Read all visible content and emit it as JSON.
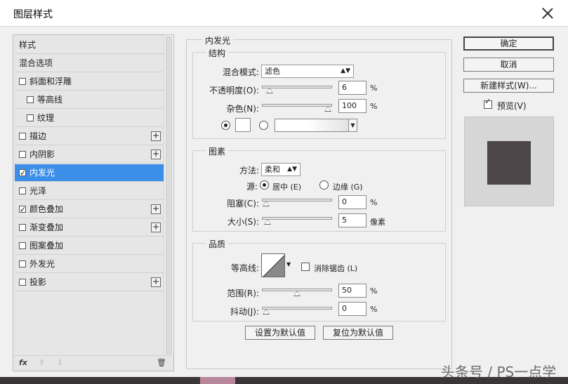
{
  "window": {
    "title": "图层样式"
  },
  "left_panel": {
    "items": [
      {
        "label": "样式",
        "checkbox": false,
        "checked": false,
        "plus": false,
        "indent": false,
        "selected": false
      },
      {
        "label": "混合选项",
        "checkbox": false,
        "checked": false,
        "plus": false,
        "indent": false,
        "selected": false
      },
      {
        "label": "斜面和浮雕",
        "checkbox": true,
        "checked": false,
        "plus": false,
        "indent": false,
        "selected": false
      },
      {
        "label": "等高线",
        "checkbox": true,
        "checked": false,
        "plus": false,
        "indent": true,
        "selected": false
      },
      {
        "label": "纹理",
        "checkbox": true,
        "checked": false,
        "plus": false,
        "indent": true,
        "selected": false
      },
      {
        "label": "描边",
        "checkbox": true,
        "checked": false,
        "plus": true,
        "indent": false,
        "selected": false
      },
      {
        "label": "内阴影",
        "checkbox": true,
        "checked": false,
        "plus": true,
        "indent": false,
        "selected": false
      },
      {
        "label": "内发光",
        "checkbox": true,
        "checked": true,
        "plus": false,
        "indent": false,
        "selected": true
      },
      {
        "label": "光泽",
        "checkbox": true,
        "checked": false,
        "plus": false,
        "indent": false,
        "selected": false
      },
      {
        "label": "颜色叠加",
        "checkbox": true,
        "checked": true,
        "plus": true,
        "indent": false,
        "selected": false
      },
      {
        "label": "渐变叠加",
        "checkbox": true,
        "checked": false,
        "plus": true,
        "indent": false,
        "selected": false
      },
      {
        "label": "图案叠加",
        "checkbox": true,
        "checked": false,
        "plus": false,
        "indent": false,
        "selected": false
      },
      {
        "label": "外发光",
        "checkbox": true,
        "checked": false,
        "plus": false,
        "indent": false,
        "selected": false
      },
      {
        "label": "投影",
        "checkbox": true,
        "checked": false,
        "plus": true,
        "indent": false,
        "selected": false
      }
    ],
    "footer": {
      "fx": "fx",
      "up": "⇧",
      "down": "⇩",
      "trash": "🗑"
    }
  },
  "inner_glow": {
    "section_title": "内发光",
    "structure": {
      "title": "结构",
      "blend_mode_label": "混合模式:",
      "blend_mode_value": "滤色",
      "opacity_label": "不透明度(O):",
      "opacity_value": "6",
      "opacity_level": 6,
      "noise_label": "杂色(N):",
      "noise_value": "100",
      "noise_level": 100,
      "percent": "%"
    },
    "elements": {
      "title": "图素",
      "method_label": "方法:",
      "method_value": "柔和",
      "source_label": "源:",
      "source_center": "居中 (E)",
      "source_edge": "边缘 (G)",
      "choke_label": "阻塞(C):",
      "choke_value": "0",
      "choke_level": 0,
      "size_label": "大小(S):",
      "size_value": "5",
      "size_level": 2,
      "px_unit": "像素",
      "percent": "%"
    },
    "quality": {
      "title": "品质",
      "contour_label": "等高线:",
      "antialias_label": "消除锯齿 (L)",
      "range_label": "范围(R):",
      "range_value": "50",
      "range_level": 50,
      "jitter_label": "抖动(J):",
      "jitter_value": "0",
      "jitter_level": 0,
      "percent": "%"
    },
    "buttons": {
      "set_default": "设置为默认值",
      "reset_default": "复位为默认值"
    }
  },
  "right_panel": {
    "ok": "确定",
    "cancel": "取消",
    "new_style": "新建样式(W)...",
    "preview_label": "预览(V)",
    "preview_checked": true,
    "preview_color": "#4d4648"
  },
  "watermark": "头条号 / PS一点学",
  "colors": {
    "selection": "#3c8fe8"
  }
}
